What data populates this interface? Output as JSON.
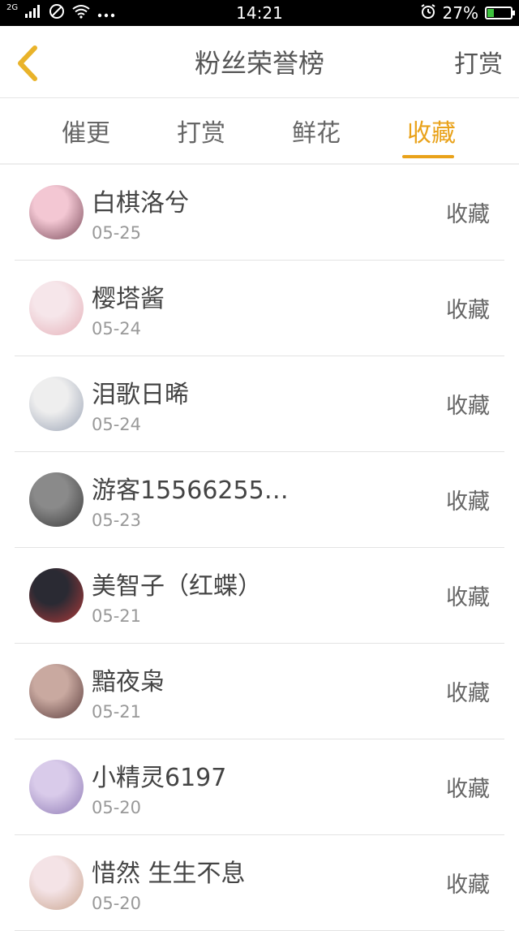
{
  "status_bar": {
    "network": "2G",
    "time": "14:21",
    "battery": "27%",
    "battery_level": 0.27,
    "icons": [
      "signal-icon",
      "do-not-disturb-icon",
      "wifi-icon",
      "more-dots-icon",
      "alarm-icon",
      "battery-charging-icon"
    ]
  },
  "header": {
    "title": "粉丝荣誉榜",
    "action": "打赏",
    "back_icon": "chevron-left-icon",
    "back_color": "#e9b32a"
  },
  "tabs": [
    {
      "label": "催更",
      "active": false
    },
    {
      "label": "打赏",
      "active": false
    },
    {
      "label": "鲜花",
      "active": false
    },
    {
      "label": "收藏",
      "active": true
    }
  ],
  "accent_color": "#e9a21a",
  "fans": [
    {
      "name": "白棋洛兮",
      "date": "05-25",
      "type": "收藏",
      "avatar_colors": [
        "#f3c7d3",
        "#7a4b5a"
      ]
    },
    {
      "name": "樱塔酱",
      "date": "05-24",
      "type": "收藏",
      "avatar_colors": [
        "#f6e6ea",
        "#e5b0b8"
      ]
    },
    {
      "name": "泪歌日晞",
      "date": "05-24",
      "type": "收藏",
      "avatar_colors": [
        "#eeeeee",
        "#9aa3b5"
      ]
    },
    {
      "name": "游客15566255…",
      "date": "05-23",
      "type": "收藏",
      "avatar_colors": [
        "#8a8a8a",
        "#3a3a3a"
      ]
    },
    {
      "name": "美智子（红蝶）",
      "date": "05-21",
      "type": "收藏",
      "avatar_colors": [
        "#2a2a33",
        "#b23a3a"
      ]
    },
    {
      "name": "黯夜枭",
      "date": "05-21",
      "type": "收藏",
      "avatar_colors": [
        "#c9a9a0",
        "#5a3c3c"
      ]
    },
    {
      "name": "小精灵6197",
      "date": "05-20",
      "type": "收藏",
      "avatar_colors": [
        "#d9cbea",
        "#8f7bb5"
      ]
    },
    {
      "name": "惜然 生生不息",
      "date": "05-20",
      "type": "收藏",
      "avatar_colors": [
        "#f4e3e6",
        "#c9a48e"
      ]
    }
  ]
}
